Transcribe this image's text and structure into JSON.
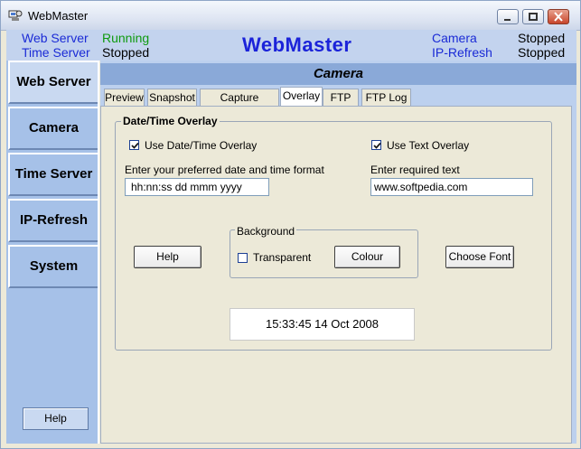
{
  "window": {
    "title": "WebMaster"
  },
  "status": {
    "web_server_label": "Web Server",
    "web_server_value": "Running",
    "time_server_label": "Time Server",
    "time_server_value": "Stopped",
    "app_title": "WebMaster",
    "camera_label": "Camera",
    "camera_value": "Stopped",
    "ip_refresh_label": "IP-Refresh",
    "ip_refresh_value": "Stopped"
  },
  "sidebar": {
    "items": [
      {
        "label": "Web Server"
      },
      {
        "label": "Camera"
      },
      {
        "label": "Time Server"
      },
      {
        "label": "IP-Refresh"
      },
      {
        "label": "System"
      }
    ],
    "help_label": "Help"
  },
  "main": {
    "section_title": "Camera",
    "tabs": [
      {
        "label": "Preview"
      },
      {
        "label": "Snapshot"
      },
      {
        "label": "Capture Options"
      },
      {
        "label": "Overlay"
      },
      {
        "label": "FTP"
      },
      {
        "label": "FTP Log"
      }
    ],
    "active_tab": "Overlay"
  },
  "overlay": {
    "group_title": "Date/Time Overlay",
    "use_datetime_label": "Use Date/Time Overlay",
    "use_datetime_checked": true,
    "use_text_label": "Use Text Overlay",
    "use_text_checked": true,
    "format_prompt": "Enter your preferred date and time format",
    "format_value": "hh:nn:ss   dd mmm yyyy",
    "text_prompt": "Enter required text",
    "text_value": "www.softpedia.com",
    "help_button": "Help",
    "background_title": "Background",
    "transparent_label": "Transparent",
    "transparent_checked": false,
    "colour_button": "Colour",
    "choose_font_button": "Choose Font",
    "preview_text": "15:33:45   14 Oct 2008"
  },
  "colors": {
    "accent_blue": "#1b2bd6",
    "running_green": "#0f9a0f",
    "sidebar_bg": "#a6c1e8",
    "header_bar": "#8aa9d8"
  },
  "icons": [
    "app-icon",
    "minimize-icon",
    "maximize-icon",
    "close-icon",
    "checkmark-icon"
  ]
}
